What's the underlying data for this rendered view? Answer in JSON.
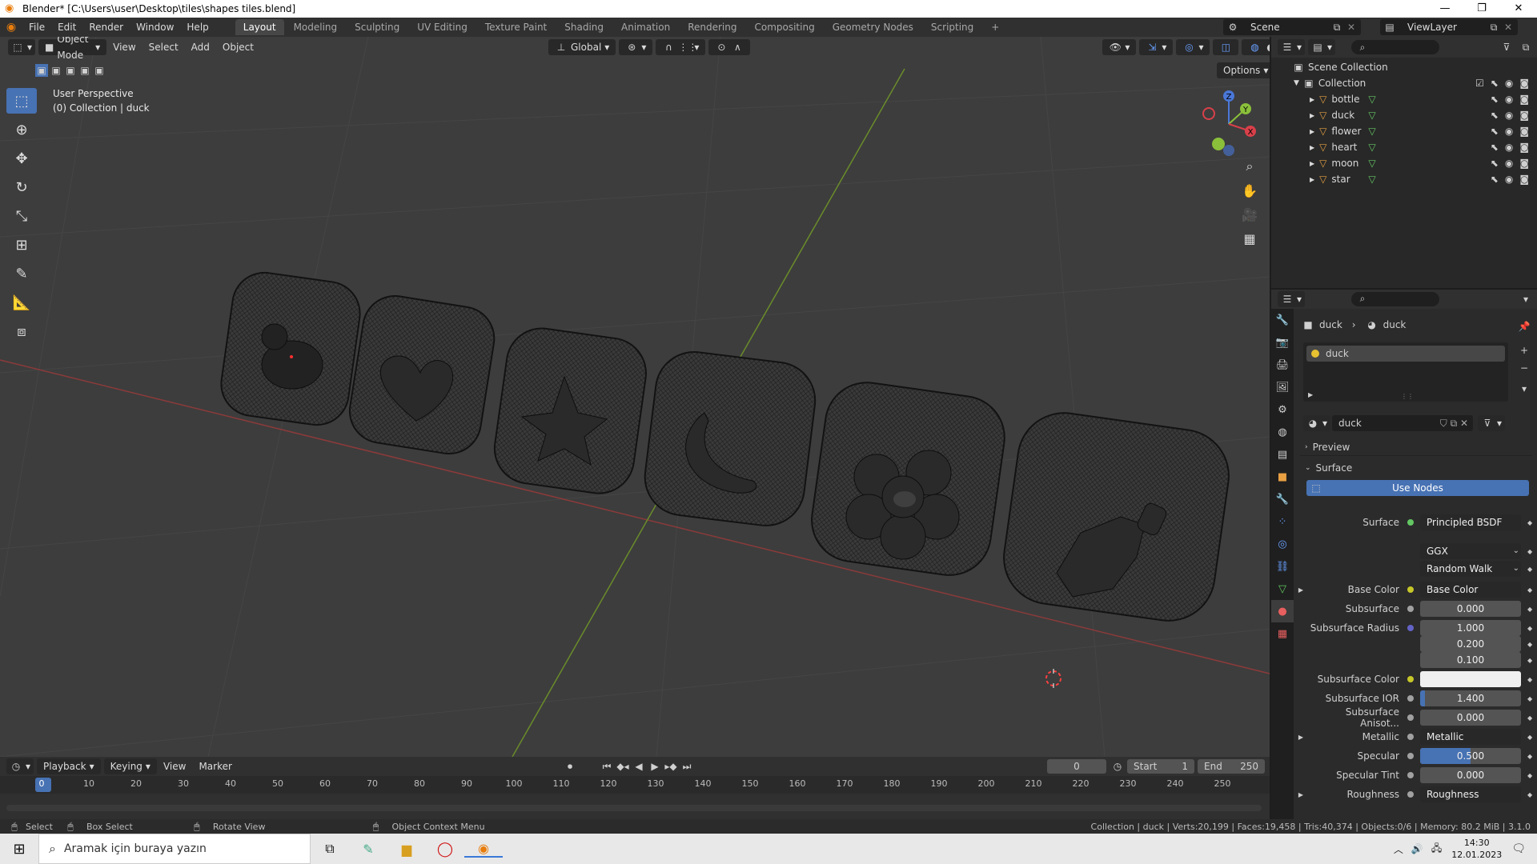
{
  "titlebar": {
    "title": "Blender* [C:\\Users\\user\\Desktop\\tiles\\shapes tiles.blend]",
    "min": "—",
    "max": "❐",
    "close": "✕"
  },
  "menu": {
    "items": [
      "File",
      "Edit",
      "Render",
      "Window",
      "Help"
    ]
  },
  "workspaces": {
    "tabs": [
      "Layout",
      "Modeling",
      "Sculpting",
      "UV Editing",
      "Texture Paint",
      "Shading",
      "Animation",
      "Rendering",
      "Compositing",
      "Geometry Nodes",
      "Scripting"
    ],
    "add": "+"
  },
  "scene": {
    "name": "Scene",
    "viewlayer": "ViewLayer"
  },
  "viewport": {
    "mode": "Object Mode",
    "menus": [
      "View",
      "Select",
      "Add",
      "Object"
    ],
    "orientation": "Global",
    "options": "Options",
    "info_line1": "User Perspective",
    "info_line2": "(0) Collection | duck"
  },
  "gizmo": {
    "z": "Z",
    "y": "Y",
    "x": "X"
  },
  "outliner": {
    "root": "Scene Collection",
    "collection": "Collection",
    "objects": [
      "bottle",
      "duck",
      "flower",
      "heart",
      "moon",
      "star"
    ]
  },
  "properties": {
    "breadcrumb_obj": "duck",
    "breadcrumb_mat": "duck",
    "slot": "duck",
    "material_name": "duck",
    "panel_preview": "Preview",
    "panel_surface": "Surface",
    "use_nodes": "Use Nodes",
    "rows": [
      {
        "label": "Surface",
        "value": "Principled BSDF",
        "type": "link",
        "dot": "#63c763"
      },
      {
        "label": "",
        "value": "GGX",
        "type": "enum"
      },
      {
        "label": "",
        "value": "Random Walk",
        "type": "enum"
      },
      {
        "label": "Base Color",
        "value": "Base Color",
        "type": "link",
        "dot": "#c7c729",
        "expand": true
      },
      {
        "label": "Subsurface",
        "value": "0.000",
        "type": "num",
        "dot": "#a1a1a1"
      },
      {
        "label": "Subsurface Radius",
        "value": "1.000",
        "type": "num",
        "dot": "#6363c7"
      },
      {
        "label": "",
        "value": "0.200",
        "type": "num"
      },
      {
        "label": "",
        "value": "0.100",
        "type": "num"
      },
      {
        "label": "Subsurface Color",
        "value": "",
        "type": "color",
        "dot": "#c7c729"
      },
      {
        "label": "Subsurface IOR",
        "value": "1.400",
        "type": "num",
        "dot": "#a1a1a1",
        "fill": 0.05
      },
      {
        "label": "Subsurface Anisot...",
        "value": "0.000",
        "type": "num",
        "dot": "#a1a1a1"
      },
      {
        "label": "Metallic",
        "value": "Metallic",
        "type": "link",
        "dot": "#a1a1a1",
        "expand": true
      },
      {
        "label": "Specular",
        "value": "0.500",
        "type": "num",
        "dot": "#a1a1a1",
        "fill": 0.5
      },
      {
        "label": "Specular Tint",
        "value": "0.000",
        "type": "num",
        "dot": "#a1a1a1"
      },
      {
        "label": "Roughness",
        "value": "Roughness",
        "type": "link",
        "dot": "#a1a1a1",
        "expand": true
      }
    ]
  },
  "timeline": {
    "menus": [
      "Playback",
      "Keying",
      "View",
      "Marker"
    ],
    "current": "0",
    "start_label": "Start",
    "start": "1",
    "end_label": "End",
    "end": "250",
    "ticks": [
      "0",
      "10",
      "20",
      "30",
      "40",
      "50",
      "60",
      "70",
      "80",
      "90",
      "100",
      "110",
      "120",
      "130",
      "140",
      "150",
      "160",
      "170",
      "180",
      "190",
      "200",
      "210",
      "220",
      "230",
      "240",
      "250"
    ]
  },
  "statusbar": {
    "select": "Select",
    "box_select": "Box Select",
    "rotate": "Rotate View",
    "context": "Object Context Menu",
    "stats": "Collection | duck | Verts:20,199 | Faces:19,458 | Tris:40,374 | Objects:0/6 | Memory: 80.2 MiB | 3.1.0"
  },
  "taskbar": {
    "search_placeholder": "Aramak için buraya yazın",
    "time": "14:30",
    "date": "12.01.2023"
  }
}
